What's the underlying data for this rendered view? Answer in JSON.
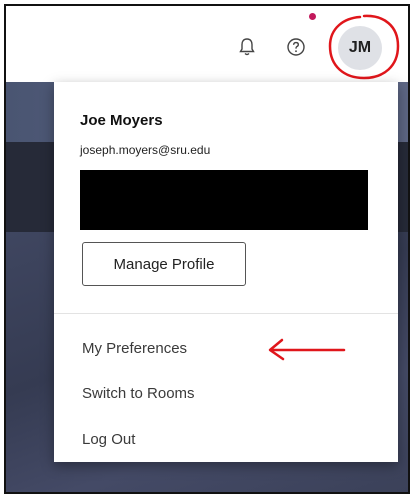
{
  "header": {
    "icons": [
      "bell-icon",
      "help-icon"
    ],
    "avatar_initials": "JM",
    "notification_dot_color": "#c2185b"
  },
  "menu": {
    "user_name": "Joe Moyers",
    "user_email": "joseph.moyers@sru.edu",
    "manage_profile_label": "Manage Profile",
    "items": [
      {
        "label": "My Preferences"
      },
      {
        "label": "Switch to Rooms"
      },
      {
        "label": "Log Out"
      }
    ]
  },
  "annotations": {
    "mark_color": "#e0161b"
  }
}
